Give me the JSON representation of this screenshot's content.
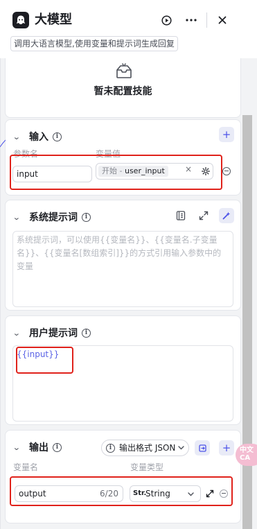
{
  "header": {
    "title": "大模型",
    "description": "调用大语言模型,使用变量和提示词生成回复"
  },
  "skill": {
    "empty_text": "暂未配置技能"
  },
  "input_section": {
    "title": "输入",
    "col_name": "参数名",
    "col_value": "变量值",
    "param_name": "input",
    "ref_source": "开始",
    "ref_separator": " - ",
    "ref_var": "user_input",
    "clear_glyph": "×"
  },
  "system_prompt": {
    "title": "系统提示词",
    "placeholder": "系统提示词，可以使用{{变量名}}、{{变量名.子变量名}}、{{变量名[数组索引]}}的方式引用输入参数中的变量"
  },
  "user_prompt": {
    "title": "用户提示词",
    "content": "{{input}}"
  },
  "output_section": {
    "title": "输出",
    "format_label": "输出格式 JSON",
    "col_name": "变量名",
    "col_type": "变量类型",
    "var_name": "output",
    "char_count": "6/20",
    "type_icon": "Str.",
    "type_value": "String"
  },
  "float_badge": {
    "line1": "中文",
    "line2": "CA"
  },
  "colors": {
    "accent": "#4d53e8",
    "highlight_box": "#e0221b",
    "panel_bg": "#f2f3f5"
  }
}
